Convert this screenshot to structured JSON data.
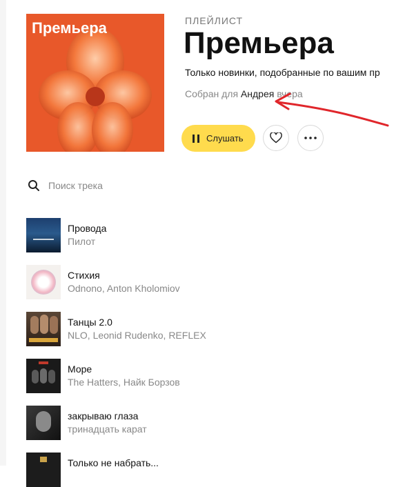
{
  "playlist": {
    "cover_title": "Премьера",
    "kicker": "ПЛЕЙЛИСТ",
    "title": "Премьера",
    "description": "Только новинки, подобранные по вашим пр",
    "collected_prefix": "Собран для",
    "collected_name": "Андрея",
    "collected_suffix": "вчера"
  },
  "actions": {
    "play_label": "Слушать",
    "like_icon": "heart-icon",
    "more_icon": "more-dots-icon"
  },
  "search": {
    "placeholder": "Поиск трека"
  },
  "tracks": [
    {
      "title": "Провода",
      "artist": "Пилот"
    },
    {
      "title": "Стихия",
      "artist": "Odnono, Anton Kholomiov"
    },
    {
      "title": "Танцы 2.0",
      "artist": "NLO, Leonid Rudenko, REFLEX"
    },
    {
      "title": "Море",
      "artist": "The Hatters, Найк Борзов"
    },
    {
      "title": "закрываю глаза",
      "artist": "тринадцать карат"
    },
    {
      "title": "Только не набрать...",
      "artist": ""
    }
  ],
  "colors": {
    "accent_yellow": "#ffdb4d",
    "cover_orange": "#e8582a",
    "annotation_red": "#e0262b"
  }
}
